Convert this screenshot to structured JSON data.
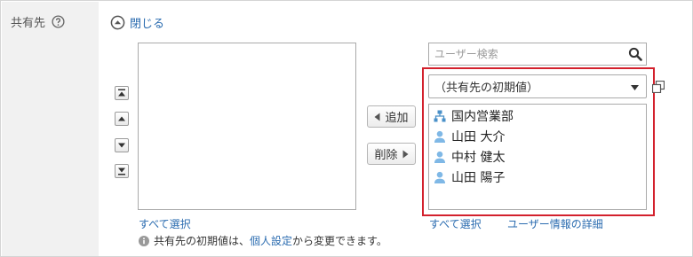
{
  "field": {
    "label": "共有先"
  },
  "collapse": {
    "label": "閉じる"
  },
  "buttons": {
    "add": "追加",
    "remove": "削除"
  },
  "search": {
    "placeholder": "ユーザー検索",
    "value": ""
  },
  "dropdown": {
    "selected": "（共有先の初期値）"
  },
  "members": [
    {
      "name": "国内営業部",
      "icon": "org-icon"
    },
    {
      "name": "山田 大介",
      "icon": "user-icon"
    },
    {
      "name": "中村 健太",
      "icon": "user-icon"
    },
    {
      "name": "山田 陽子",
      "icon": "user-icon"
    }
  ],
  "links": {
    "select_all_left": "すべて選択",
    "select_all_right": "すべて選択",
    "user_details": "ユーザー情報の詳細"
  },
  "note": {
    "prefix": "共有先の初期値は、",
    "link": "個人設定",
    "suffix": "から変更できます。"
  },
  "colors": {
    "link": "#2b6cb0",
    "highlight": "#d3212d",
    "user_icon": "#7fb8e6",
    "org_icon": "#4a90c8"
  }
}
